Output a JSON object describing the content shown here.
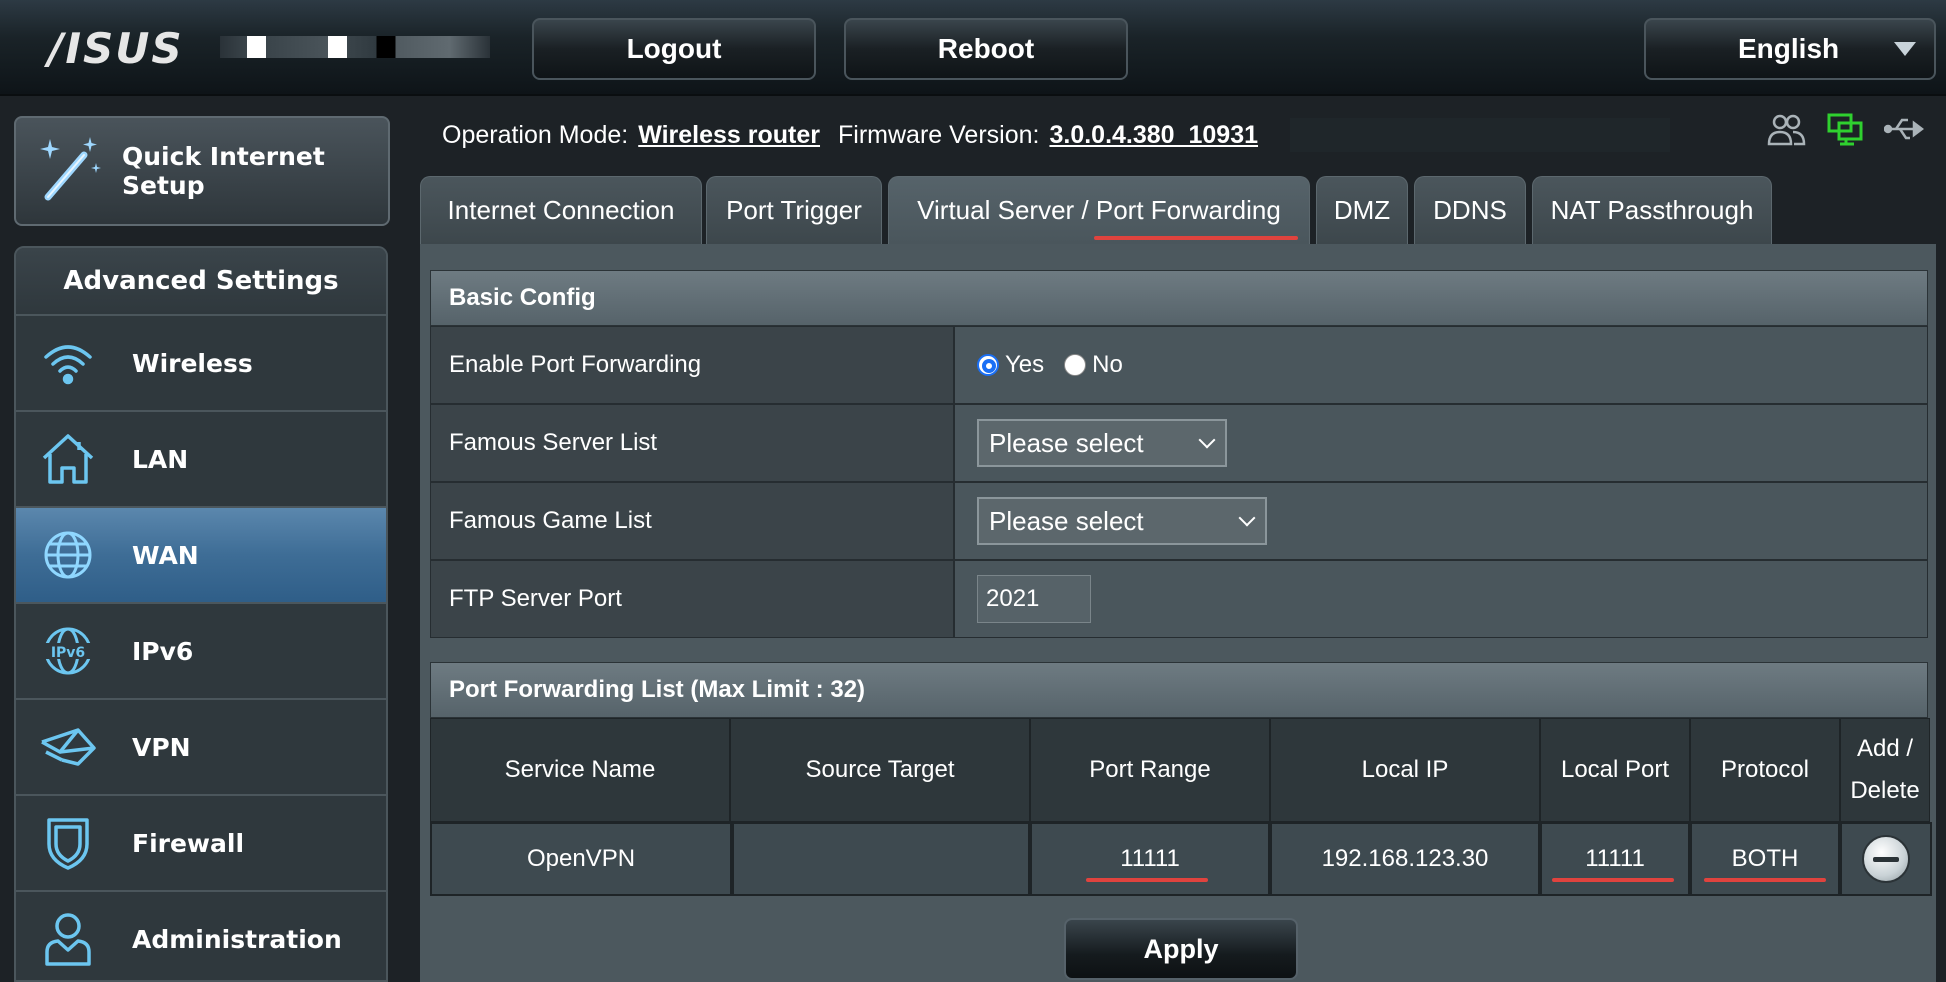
{
  "brand": {
    "logo": "/ISUS"
  },
  "header": {
    "logout_label": "Logout",
    "reboot_label": "Reboot",
    "language": "English"
  },
  "quick_setup": {
    "label": "Quick Internet\nSetup"
  },
  "sidebar": {
    "heading": "Advanced Settings",
    "items": [
      {
        "label": "Wireless",
        "icon": "wifi-icon"
      },
      {
        "label": "LAN",
        "icon": "home-icon"
      },
      {
        "label": "WAN",
        "icon": "globe-icon",
        "active": true
      },
      {
        "label": "IPv6",
        "icon": "ipv6-icon"
      },
      {
        "label": "VPN",
        "icon": "vpn-icon"
      },
      {
        "label": "Firewall",
        "icon": "shield-icon"
      },
      {
        "label": "Administration",
        "icon": "user-icon"
      }
    ]
  },
  "status": {
    "mode_label": "Operation Mode:",
    "mode_value": "Wireless router",
    "fw_label": "Firmware Version:",
    "fw_value": "3.0.0.4.380_10931"
  },
  "tabs": [
    {
      "label": "Internet Connection"
    },
    {
      "label": "Port Trigger"
    },
    {
      "label": "Virtual Server / Port Forwarding",
      "active": true
    },
    {
      "label": "DMZ"
    },
    {
      "label": "DDNS"
    },
    {
      "label": "NAT Passthrough"
    }
  ],
  "basic_config": {
    "heading": "Basic Config",
    "enable_label": "Enable Port Forwarding",
    "yes_label": "Yes",
    "no_label": "No",
    "enabled": "Yes",
    "famous_server_label": "Famous Server List",
    "famous_server_value": "Please select",
    "famous_game_label": "Famous Game List",
    "famous_game_value": "Please select",
    "ftp_label": "FTP Server Port",
    "ftp_value": "2021"
  },
  "port_list": {
    "heading": "Port Forwarding List (Max Limit : 32)",
    "columns": [
      "Service Name",
      "Source Target",
      "Port Range",
      "Local IP",
      "Local Port",
      "Protocol",
      "Add /\nDelete"
    ],
    "rows": [
      {
        "service": "OpenVPN",
        "source": "",
        "port_range": "11111",
        "local_ip": "192.168.123.30",
        "local_port": "11111",
        "protocol": "BOTH"
      }
    ]
  },
  "apply_label": "Apply",
  "colors": {
    "accent_underline": "#e0433e",
    "active_nav": "#3e6d96",
    "radio": "#1a6ff5"
  }
}
